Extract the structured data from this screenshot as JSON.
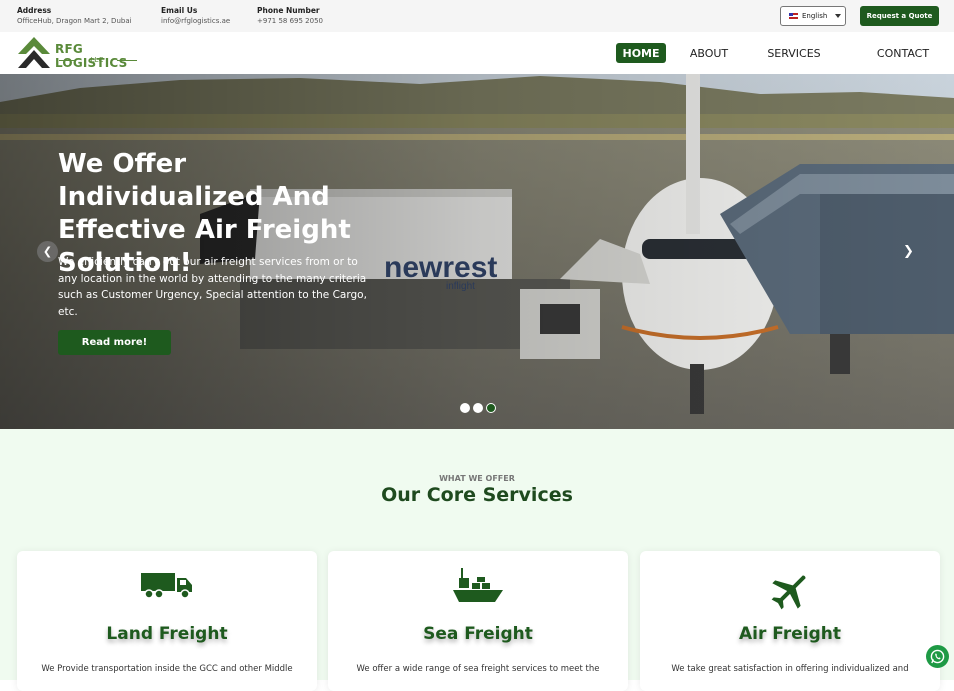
{
  "topbar": {
    "address": {
      "label": "Address",
      "value": "OfficeHub, Dragon Mart 2, Dubai"
    },
    "email": {
      "label": "Email Us",
      "value": "info@rfglogistics.ae"
    },
    "phone": {
      "label": "Phone Number",
      "value": "+971 58 695 2050"
    },
    "language": "English",
    "quote_button": "Request a Quote"
  },
  "brand": {
    "name": "RFG LOGISTICS",
    "suffix": "LLC",
    "color": "#5a8a3a"
  },
  "nav": [
    {
      "label": "HOME",
      "active": true
    },
    {
      "label": "ABOUT",
      "active": false
    },
    {
      "label": "SERVICES",
      "active": false
    },
    {
      "label": "CONTACT",
      "active": false
    }
  ],
  "hero": {
    "title": "We Offer Individualized And Effective Air Freight Solution!",
    "description": "We efficiently carry out our air freight services from or to any location in the world by attending to the many criteria such as Customer Urgency, Special attention to the Cargo, etc.",
    "button": "Read more!",
    "truck_logo": "newrest",
    "truck_logo_sub": "inflight",
    "slides_total": 3,
    "active_slide": 3
  },
  "services": {
    "eyebrow": "WHAT WE OFFER",
    "title": "Our Core Services",
    "cards": [
      {
        "icon": "truck-icon",
        "title": "Land Freight",
        "text": "We Provide transportation inside the GCC and other Middle"
      },
      {
        "icon": "ship-icon",
        "title": "Sea Freight",
        "text": "We offer a wide range of sea freight services to meet the"
      },
      {
        "icon": "airplane-icon",
        "title": "Air Freight",
        "text": "We take great satisfaction in offering individualized and"
      }
    ]
  },
  "colors": {
    "primary": "#1e5a1e",
    "accent": "#5a8a3a",
    "section_bg": "#f0fbf0"
  }
}
